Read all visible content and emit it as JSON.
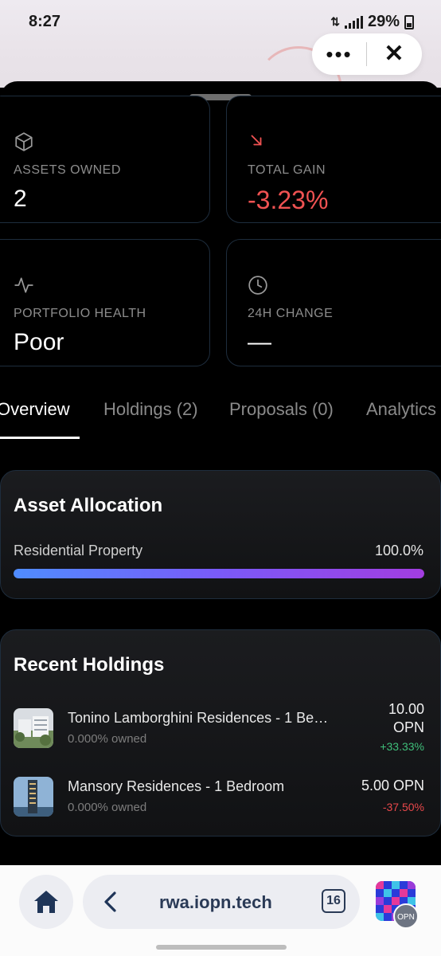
{
  "status": {
    "time": "8:27",
    "battery": "29%"
  },
  "top_pill": {
    "more_icon": "more-dots-icon",
    "close_icon": "close-icon"
  },
  "stats": [
    {
      "icon": "cube-icon",
      "label": "ASSETS OWNED",
      "value": "2"
    },
    {
      "icon": "trend-down-icon",
      "label": "TOTAL GAIN",
      "value": "-3.23%",
      "color": "#f05252"
    },
    {
      "icon": "pulse-icon",
      "label": "PORTFOLIO HEALTH",
      "value": "Poor"
    },
    {
      "icon": "clock-icon",
      "label": "24H CHANGE",
      "value": "—"
    }
  ],
  "tabs": [
    "Overview",
    "Holdings (2)",
    "Proposals (0)",
    "Analytics"
  ],
  "active_tab": "Overview",
  "allocation": {
    "title": "Asset Allocation",
    "items": [
      {
        "label": "Residential Property",
        "value": "100.0%",
        "percent": 100
      }
    ]
  },
  "holdings": {
    "title": "Recent Holdings",
    "items": [
      {
        "name": "Tonino Lamborghini Residences - 1 Be…",
        "owned": "0.000% owned",
        "price": "10.00 OPN",
        "change": "+33.33%",
        "positive": true
      },
      {
        "name": "Mansory Residences - 1 Bedroom",
        "owned": "0.000% owned",
        "price": "5.00 OPN",
        "change": "-37.50%",
        "positive": false
      }
    ]
  },
  "browser": {
    "url": "rwa.iopn.tech",
    "tab_count": "16",
    "badge": "OPN"
  },
  "colors": {
    "accent_negative": "#f05252",
    "accent_positive": "#3fbf7a",
    "card_border": "#1e2d3d"
  }
}
